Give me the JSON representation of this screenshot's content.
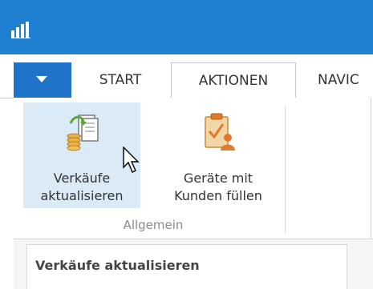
{
  "ribbon": {
    "tabs": [
      {
        "label": "START"
      },
      {
        "label": "AKTIONEN"
      },
      {
        "label": "NAVIC"
      }
    ],
    "buttons": [
      {
        "line1": "Verkäufe",
        "line2": "aktualisieren",
        "icon": "documents-coins-icon"
      },
      {
        "line1": "Geräte mit",
        "line2": "Kunden füllen",
        "icon": "clipboard-check-user-icon"
      }
    ],
    "group_label": "Allgemein"
  },
  "panel": {
    "title": "Verkäufe aktualisieren"
  },
  "colors": {
    "titlebar": "#1f7fd0",
    "file_tab": "#1f73c8",
    "selected_button": "#dbeaf7"
  }
}
